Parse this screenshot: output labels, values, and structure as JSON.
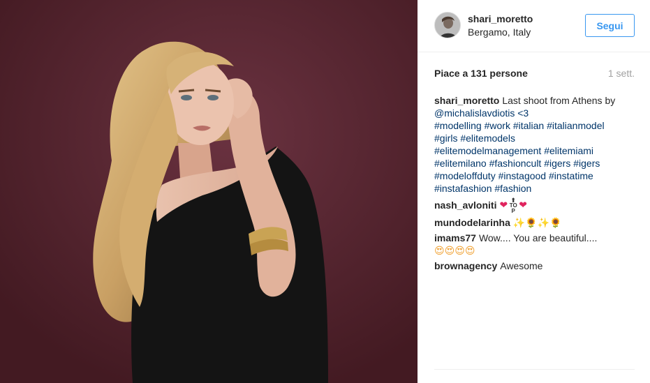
{
  "post": {
    "photo_alt": "Model in black one-shoulder dress against burgundy wall",
    "header": {
      "username": "shari_moretto",
      "location": "Bergamo, Italy",
      "follow_label": "Segui"
    },
    "likes_text": "Piace a 131 persone",
    "time_ago": "1 sett.",
    "caption": {
      "user": "shari_moretto",
      "text_first": "Last shoot from Athens by",
      "lines": [
        "@michalislavdiotis <3",
        "#modelling #work #italian #italianmodel",
        "#girls #elitemodels",
        "#elitemodelmanagement #elitemiami",
        "#elitemilano #fashioncult #igers #igers",
        "#modeloffduty #instagood #instatime",
        "#instafashion #fashion"
      ]
    },
    "comments": [
      {
        "user": "nash_avloniti",
        "text": ""
      },
      {
        "user": "mundodelarinha",
        "text": ""
      },
      {
        "user": "imams77",
        "text": "Wow.... You are beautiful...."
      },
      {
        "user": "brownagency",
        "text": "Awesome"
      }
    ],
    "emoji": {
      "heart": "❤",
      "top": "TOP",
      "sparkle": "✨",
      "sunflower": "🌻",
      "heart_eyes": "😍"
    }
  },
  "colors": {
    "accent": "#3897f0",
    "link": "#003569",
    "muted": "#a0a0a0",
    "text": "#262626",
    "wall": "#5a2833"
  }
}
